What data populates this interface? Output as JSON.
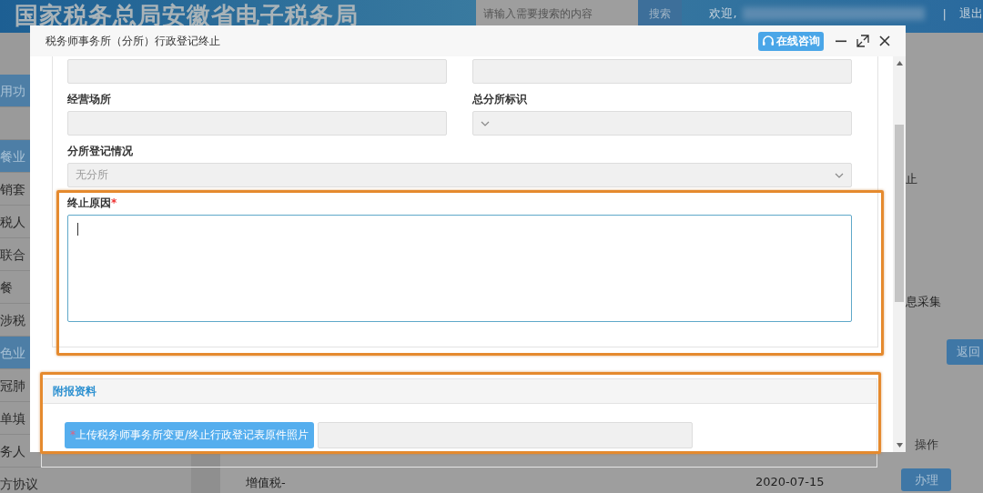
{
  "header": {
    "title": "国家税务总局安徽省电子税务局",
    "search_placeholder": "请输入需要搜索的内容",
    "search_button": "搜索",
    "welcome": "欢迎,",
    "separator": "|",
    "logout": "退出"
  },
  "sidebar": {
    "items": [
      {
        "kind": "group",
        "label": "用功"
      },
      {
        "kind": "blank"
      },
      {
        "kind": "group",
        "label": "餐业"
      },
      {
        "kind": "item",
        "label": "销套"
      },
      {
        "kind": "item",
        "label": "税人"
      },
      {
        "kind": "item",
        "label": "联合"
      },
      {
        "kind": "item",
        "label": "餐"
      },
      {
        "kind": "item",
        "label": "涉税"
      },
      {
        "kind": "group",
        "label": "色业"
      },
      {
        "kind": "item",
        "label": "冠肺"
      },
      {
        "kind": "item",
        "label": "单填"
      },
      {
        "kind": "item",
        "label": "务人"
      },
      {
        "kind": "item",
        "label": "方协议"
      }
    ]
  },
  "background": {
    "side_texts": [
      "止",
      "息采集"
    ],
    "back_button": "返回",
    "column_header": "操作",
    "row": {
      "name": "增值税-",
      "date": "2020-07-15",
      "action": "办理"
    }
  },
  "dialog": {
    "title": "税务师事务所（分所）行政登记终止",
    "consult_button": "在线咨询",
    "rows": [
      [
        {
          "kind": "input"
        },
        {
          "kind": "input"
        }
      ],
      [
        {
          "kind": "input",
          "label": "经营场所"
        },
        {
          "kind": "select",
          "label": "总分所标识"
        }
      ],
      [
        {
          "kind": "select",
          "label": "分所登记情况",
          "value": "无分所"
        }
      ]
    ],
    "reason": {
      "label": "终止原因",
      "required_mark": "*"
    },
    "attachments": {
      "title": "附报资料",
      "upload_button": "上传税务师事务所变更/终止行政登记表原件照片",
      "required_mark": "*"
    }
  }
}
